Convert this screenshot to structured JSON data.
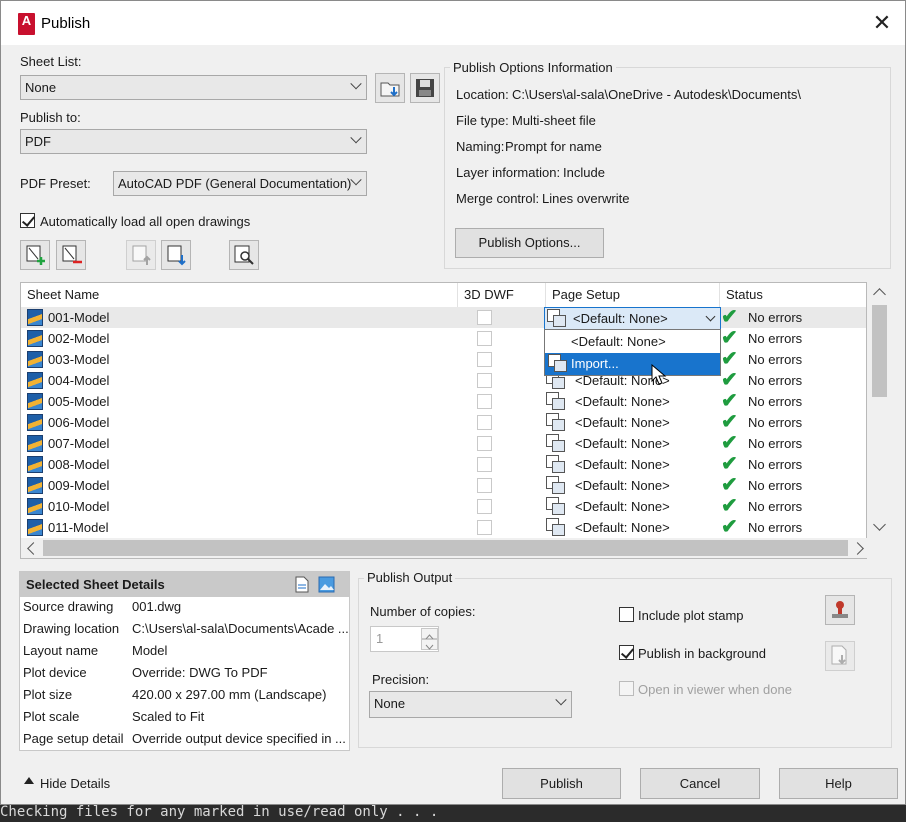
{
  "window": {
    "title": "Publish"
  },
  "console": {
    "text": "Checking files for any marked in use/read only . . ."
  },
  "sheet_list": {
    "label": "Sheet List:",
    "value": "None"
  },
  "publish_to": {
    "label": "Publish to:",
    "value": "PDF"
  },
  "pdf_preset": {
    "label": "PDF Preset:",
    "value": "AutoCAD PDF (General Documentation)"
  },
  "auto_load": {
    "label": "Automatically load all open drawings",
    "checked": true
  },
  "publish_info": {
    "title": "Publish Options Information",
    "location_label": "Location:",
    "location_value": "C:\\Users\\al-sala\\OneDrive - Autodesk\\Documents\\",
    "filetype_label": "File type:",
    "filetype_value": "Multi-sheet file",
    "naming_label": "Naming:",
    "naming_value": "Prompt for name",
    "layer_label": "Layer information:",
    "layer_value": "Include",
    "merge_label": "Merge control:",
    "merge_value": "Lines overwrite",
    "options_button": "Publish Options..."
  },
  "table": {
    "headers": [
      "Sheet Name",
      "3D DWF",
      "Page Setup",
      "Status"
    ],
    "rows": [
      {
        "name": "001-Model",
        "setup": "<Default: None>",
        "status": "No errors"
      },
      {
        "name": "002-Model",
        "setup": "<Default: None>",
        "status": "No errors"
      },
      {
        "name": "003-Model",
        "setup": "<Default: None>",
        "status": "No errors"
      },
      {
        "name": "004-Model",
        "setup": "<Default: None>",
        "status": "No errors"
      },
      {
        "name": "005-Model",
        "setup": "<Default: None>",
        "status": "No errors"
      },
      {
        "name": "006-Model",
        "setup": "<Default: None>",
        "status": "No errors"
      },
      {
        "name": "007-Model",
        "setup": "<Default: None>",
        "status": "No errors"
      },
      {
        "name": "008-Model",
        "setup": "<Default: None>",
        "status": "No errors"
      },
      {
        "name": "009-Model",
        "setup": "<Default: None>",
        "status": "No errors"
      },
      {
        "name": "010-Model",
        "setup": "<Default: None>",
        "status": "No errors"
      },
      {
        "name": "011-Model",
        "setup": "<Default: None>",
        "status": "No errors"
      }
    ],
    "dropdown_options": [
      "<Default: None>",
      "Import..."
    ]
  },
  "details": {
    "title": "Selected Sheet Details",
    "rows": [
      {
        "k": "Source drawing",
        "v": "001.dwg"
      },
      {
        "k": "Drawing location",
        "v": "C:\\Users\\al-sala\\Documents\\Acade ..."
      },
      {
        "k": "Layout name",
        "v": "Model"
      },
      {
        "k": "Plot device",
        "v": "Override: DWG To PDF"
      },
      {
        "k": "Plot size",
        "v": "420.00 x 297.00 mm (Landscape)"
      },
      {
        "k": "Plot scale",
        "v": "Scaled to Fit"
      },
      {
        "k": "Page setup detail",
        "v": "Override output device specified in ..."
      }
    ]
  },
  "output": {
    "title": "Publish Output",
    "copies_label": "Number of copies:",
    "copies_value": "1",
    "precision_label": "Precision:",
    "precision_value": "None",
    "plot_stamp": "Include plot stamp",
    "background": "Publish in background",
    "open_viewer": "Open in viewer when done"
  },
  "footer": {
    "hide_details": "Hide Details",
    "publish": "Publish",
    "cancel": "Cancel",
    "help": "Help"
  },
  "colors": {
    "accent": "#1874cd",
    "ok": "#1f9c3f",
    "logo": "#c8102e"
  }
}
